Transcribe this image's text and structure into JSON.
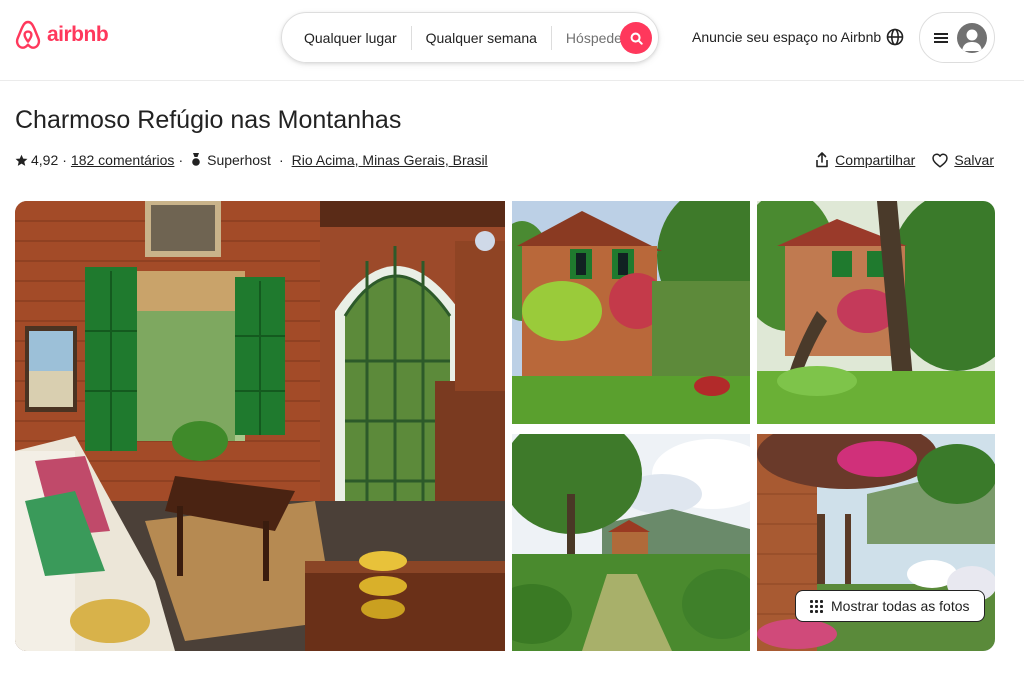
{
  "header": {
    "logo_text": "airbnb",
    "search": {
      "location": "Qualquer lugar",
      "dates": "Qualquer semana",
      "guests": "Hóspedes?"
    },
    "host_link": "Anuncie seu espaço no Airbnb",
    "icons": {
      "logo": "airbnb-logo-icon",
      "search": "search-icon",
      "globe": "globe-icon",
      "menu": "hamburger-menu-icon",
      "avatar": "user-avatar-icon"
    }
  },
  "listing": {
    "title": "Charmoso Refúgio nas Montanhas",
    "rating": "4,92",
    "reviews": "182 comentários",
    "host_badge": "Superhost",
    "location": "Rio Acima, Minas Gerais, Brasil",
    "share_label": "Compartilhar",
    "save_label": "Salvar"
  },
  "gallery": {
    "show_all_label": "Mostrar todas as fotos",
    "photos": [
      "living-room-photo",
      "house-front-photo",
      "house-garden-photo",
      "house-valley-photo",
      "terrace-flowers-photo"
    ]
  },
  "colors": {
    "brand": "#ff385c",
    "text": "#222222",
    "muted": "#717171",
    "border": "#dddddd"
  }
}
